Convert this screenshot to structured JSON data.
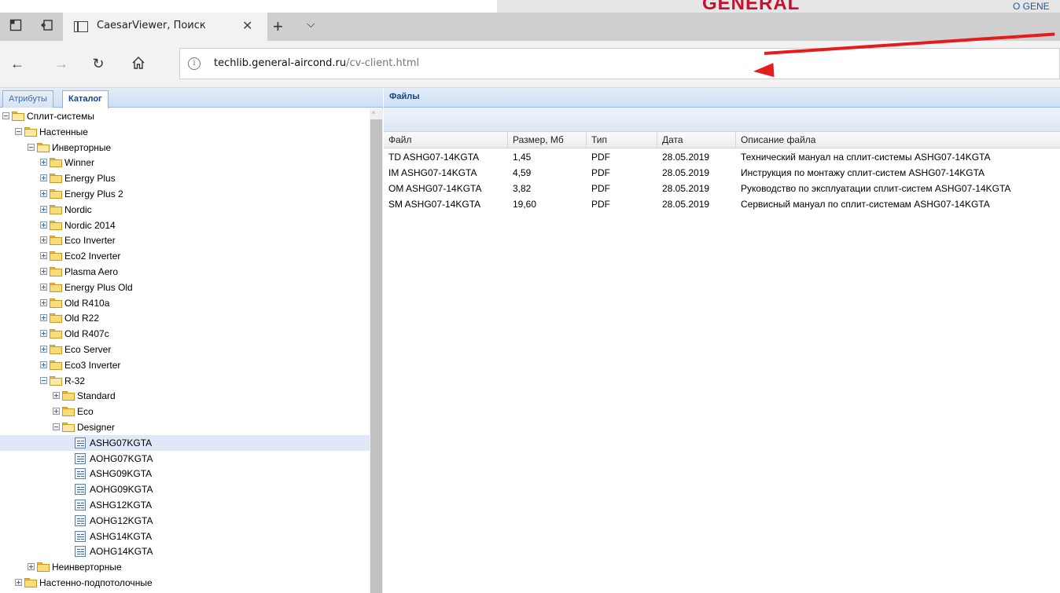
{
  "banner": {
    "logo_text": "GENERAL",
    "link_text": "О GENE"
  },
  "browser": {
    "tab_title": "CaesarViewer, Поиск",
    "url_host": "techlib.general-aircond.ru",
    "url_path": "/cv-client.html"
  },
  "left_panel": {
    "tabs": [
      "Атрибуты",
      "Каталог"
    ],
    "active_tab": "Каталог",
    "tree": [
      {
        "label": "Сплит-системы",
        "depth": 0,
        "kind": "folder",
        "expanded": true
      },
      {
        "label": "Настенные",
        "depth": 1,
        "kind": "folder",
        "expanded": true
      },
      {
        "label": "Инверторные",
        "depth": 2,
        "kind": "folder",
        "expanded": true
      },
      {
        "label": "Winner",
        "depth": 3,
        "kind": "folder",
        "expanded": false
      },
      {
        "label": "Energy Plus",
        "depth": 3,
        "kind": "folder",
        "expanded": false
      },
      {
        "label": "Energy Plus 2",
        "depth": 3,
        "kind": "folder",
        "expanded": false
      },
      {
        "label": "Nordic",
        "depth": 3,
        "kind": "folder",
        "expanded": false
      },
      {
        "label": "Nordic 2014",
        "depth": 3,
        "kind": "folder",
        "expanded": false
      },
      {
        "label": "Eco Inverter",
        "depth": 3,
        "kind": "folder",
        "expanded": false
      },
      {
        "label": "Eco2 Inverter",
        "depth": 3,
        "kind": "folder",
        "expanded": false
      },
      {
        "label": "Plasma Aero",
        "depth": 3,
        "kind": "folder",
        "expanded": false
      },
      {
        "label": "Energy Plus Old",
        "depth": 3,
        "kind": "folder",
        "expanded": false
      },
      {
        "label": "Old R410a",
        "depth": 3,
        "kind": "folder",
        "expanded": false
      },
      {
        "label": "Old R22",
        "depth": 3,
        "kind": "folder",
        "expanded": false
      },
      {
        "label": "Old R407c",
        "depth": 3,
        "kind": "folder",
        "expanded": false
      },
      {
        "label": "Eco Server",
        "depth": 3,
        "kind": "folder",
        "expanded": false
      },
      {
        "label": "Eco3 Inverter",
        "depth": 3,
        "kind": "folder",
        "expanded": false
      },
      {
        "label": "R-32",
        "depth": 3,
        "kind": "folder",
        "expanded": true
      },
      {
        "label": "Standard",
        "depth": 4,
        "kind": "folder",
        "expanded": false
      },
      {
        "label": "Eco",
        "depth": 4,
        "kind": "folder",
        "expanded": false
      },
      {
        "label": "Designer",
        "depth": 4,
        "kind": "folder",
        "expanded": true
      },
      {
        "label": "ASHG07KGTA",
        "depth": 5,
        "kind": "doc",
        "selected": true
      },
      {
        "label": "AOHG07KGTA",
        "depth": 5,
        "kind": "doc"
      },
      {
        "label": "ASHG09KGTA",
        "depth": 5,
        "kind": "doc"
      },
      {
        "label": "AOHG09KGTA",
        "depth": 5,
        "kind": "doc"
      },
      {
        "label": "ASHG12KGTA",
        "depth": 5,
        "kind": "doc"
      },
      {
        "label": "AOHG12KGTA",
        "depth": 5,
        "kind": "doc"
      },
      {
        "label": "ASHG14KGTA",
        "depth": 5,
        "kind": "doc"
      },
      {
        "label": "AOHG14KGTA",
        "depth": 5,
        "kind": "doc"
      },
      {
        "label": "Неинверторные",
        "depth": 2,
        "kind": "folder",
        "expanded": false
      },
      {
        "label": "Настенно-подпотолочные",
        "depth": 1,
        "kind": "folder",
        "expanded": false
      }
    ]
  },
  "right_panel": {
    "title": "Файлы",
    "columns": [
      "Файл",
      "Размер, Мб",
      "Тип",
      "Дата",
      "Описание файла"
    ],
    "rows": [
      [
        "TD ASHG07-14KGTA",
        "1,45",
        "PDF",
        "28.05.2019",
        "Технический мануал на сплит-системы ASHG07-14KGTA"
      ],
      [
        "IM ASHG07-14KGTA",
        "4,59",
        "PDF",
        "28.05.2019",
        "Инструкция по монтажу сплит-систем ASHG07-14KGTA"
      ],
      [
        "OM ASHG07-14KGTA",
        "3,82",
        "PDF",
        "28.05.2019",
        "Руководство по эксплуатации сплит-систем ASHG07-14KGTA"
      ],
      [
        "SM ASHG07-14KGTA",
        "19,60",
        "PDF",
        "28.05.2019",
        "Сервисный мануал по сплит-системам ASHG07-14KGTA"
      ]
    ]
  },
  "colors": {
    "annotation_arrow": "#e51c1c",
    "panel_header_text": "#15428b",
    "selected_row": "#dfe8f6",
    "logo": "#c8102e"
  }
}
